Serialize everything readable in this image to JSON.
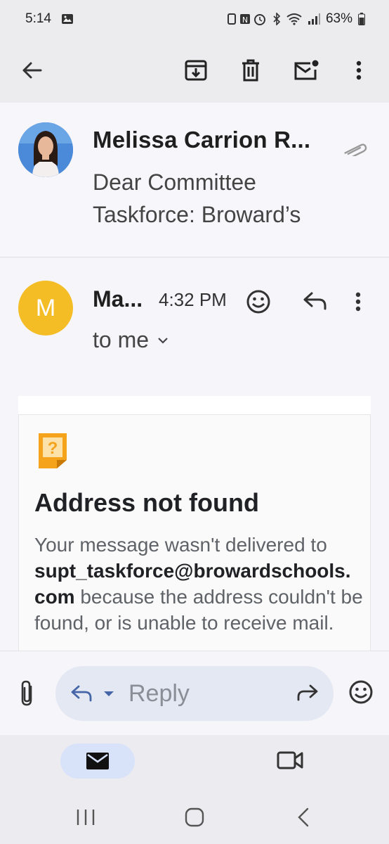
{
  "status_bar": {
    "time": "5:14",
    "battery": "63%"
  },
  "toolbar": {
    "back_icon": "arrow-back-icon",
    "archive_icon": "archive-icon",
    "delete_icon": "trash-icon",
    "mark_unread_icon": "mark-unread-icon",
    "more_icon": "more-vert-icon"
  },
  "thread_header": {
    "sender": "Melissa Carrion R...",
    "snippet_line1": "Dear Committee",
    "snippet_line2": "Taskforce: Broward’s"
  },
  "message": {
    "avatar_letter": "M",
    "from": "Ma...",
    "time": "4:32 PM",
    "recipient": "to me"
  },
  "bounce": {
    "title": "Address not found",
    "body_prefix": "Your message wasn't delivered to ",
    "address_line1": "supt_taskforce@browardschools.",
    "address_line2": "com",
    "body_suffix": " because the address couldn't be found, or is unable to receive mail."
  },
  "reply_bar": {
    "placeholder": "Reply"
  },
  "colors": {
    "avatar_m": "#f4bd26",
    "mail_tab_active": "#d8e3fa",
    "bounce_icon": "#f4a31a"
  }
}
